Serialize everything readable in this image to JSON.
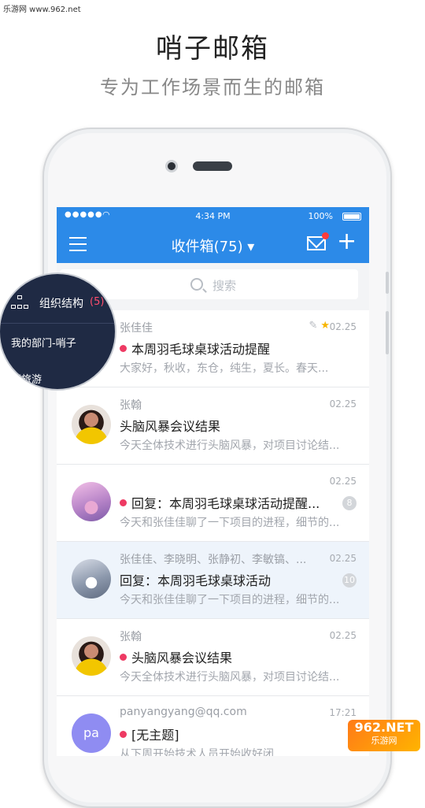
{
  "watermark": "乐游网 www.962.net",
  "promo": {
    "title": "哨子邮箱",
    "subtitle": "专为工作场景而生的邮箱"
  },
  "status_bar": {
    "signal": "●●●●●",
    "time": "4:34 PM",
    "battery": "100%"
  },
  "navbar": {
    "title": "收件箱(75) ▾"
  },
  "search": {
    "placeholder": "搜索"
  },
  "overlay": {
    "org_label": "组织结构",
    "org_count": "(5)",
    "dept": "我的部门-哨子",
    "partial": "莆旅游"
  },
  "emails": [
    {
      "sender": "张佳佳",
      "date": "02.25",
      "subject": "本周羽毛球桌球活动提醒",
      "preview": "大家好，秋收，东仓，纯生，夏长。春天...",
      "unread": true,
      "has_attachment": true,
      "starred": true,
      "count": "",
      "avatar": "none"
    },
    {
      "sender": "张翰",
      "date": "02.25",
      "subject": "头脑风暴会议结果",
      "preview": "今天全体技术进行头脑风暴，对项目讨论结...",
      "unread": false,
      "count": "",
      "avatar": "face"
    },
    {
      "sender": "",
      "date": "02.25",
      "subject": "回复：本周羽毛球桌球活动提醒...",
      "preview": "今天和张佳佳聊了一下项目的进程，细节的...",
      "unread": true,
      "count": "8",
      "avatar": "castle"
    },
    {
      "sender": "张佳佳、李晓明、张静初、李敏镐、...",
      "date": "02.25",
      "subject": "回复：本周羽毛球桌球活动",
      "preview": "今天和张佳佳聊了一下项目的进程，细节的...",
      "unread": false,
      "count": "10",
      "avatar": "winter"
    },
    {
      "sender": "张翰",
      "date": "02.25",
      "subject": "头脑风暴会议结果",
      "preview": "今天全体技术进行头脑风暴，对项目讨论结...",
      "unread": true,
      "count": "",
      "avatar": "face"
    },
    {
      "sender": "panyangyang@qq.com",
      "date": "17:21",
      "subject": "[无主题]",
      "preview": "从下周开始技术人员开始收好闭...",
      "unread": true,
      "count": "",
      "avatar": "pa",
      "avatar_text": "pa"
    }
  ],
  "brand": {
    "line1": "962.NET",
    "line2": "乐游网"
  },
  "colors": {
    "accent": "#2c8ae8",
    "unread_dot": "#ee3a63",
    "star": "#f7b500",
    "overlay_bg": "#1f2a44"
  }
}
